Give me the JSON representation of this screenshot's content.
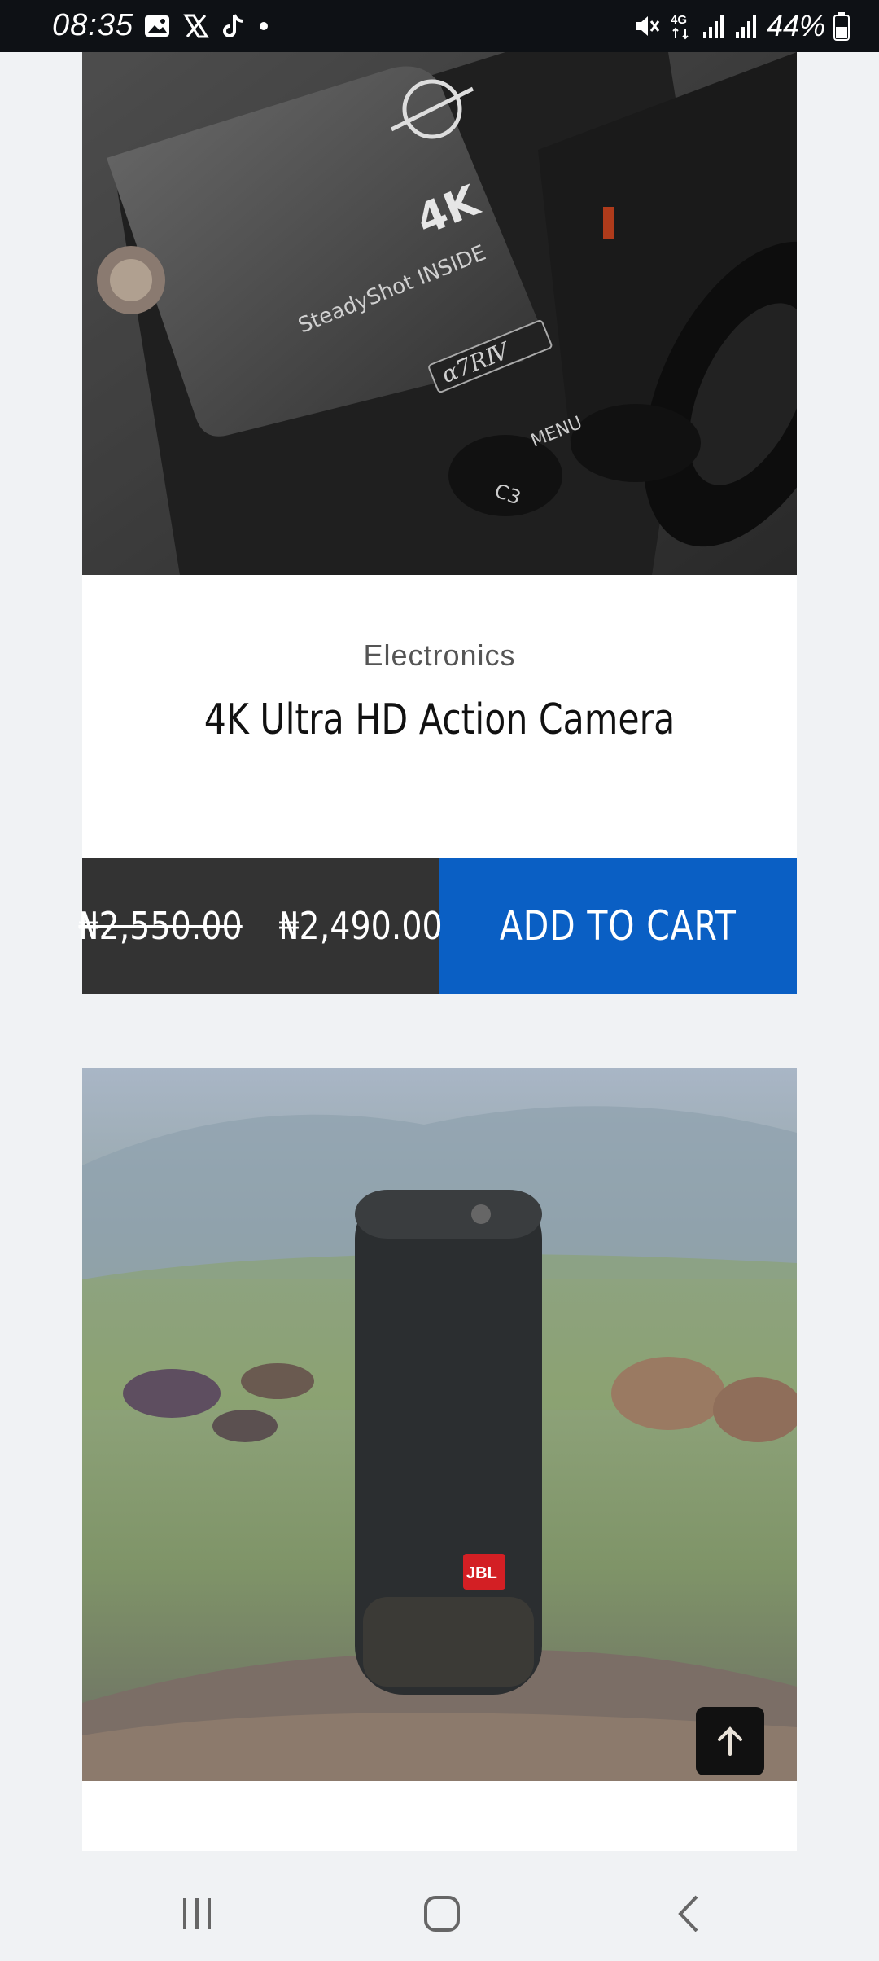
{
  "status_bar": {
    "time": "08:35",
    "left_icons": [
      "gallery-icon",
      "x-icon",
      "tiktok-icon",
      "dot-icon"
    ],
    "right_icons": [
      "mute-icon",
      "4g-icon",
      "signal-icon",
      "signal-icon",
      "battery-icon"
    ],
    "network": "4G",
    "battery": "44%"
  },
  "products": [
    {
      "category": "Electronics",
      "title": "4K Ultra HD Action Camera",
      "old_price": "₦2,550.00",
      "price": "₦2,490.00",
      "cta": "ADD TO CART",
      "image": {
        "type": "camera-closeup",
        "labels": [
          "4K",
          "SteadyShot INSIDE",
          "α7RⅣ",
          "MENU",
          "C3"
        ]
      }
    },
    {
      "image": {
        "type": "jbl-speaker-on-rock",
        "labels": [
          "JBL"
        ]
      }
    }
  ],
  "scroll_top": {
    "icon": "arrow-up-icon"
  },
  "nav_bar": {
    "buttons": [
      "recent-apps-icon",
      "home-icon",
      "back-icon"
    ]
  },
  "colors": {
    "price_bg": "#333333",
    "cart_bg": "#0a5fc4",
    "page_bg": "#f0f2f4",
    "status_bg": "#0e1115"
  }
}
